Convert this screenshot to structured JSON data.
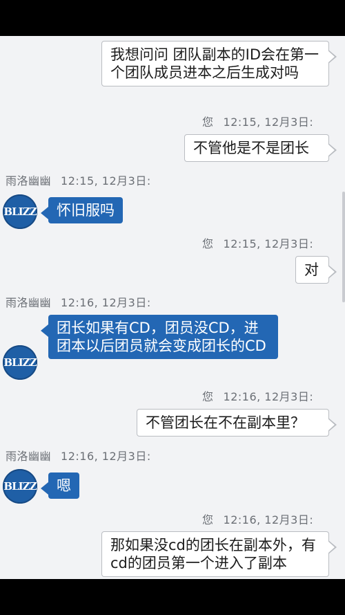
{
  "conversation": {
    "messages": [
      {
        "side": "out",
        "text": "我想问问 团队副本的ID会在第一个团队成员进本之后生成对吗"
      },
      {
        "side": "out",
        "meta_who": "您",
        "meta_time": "12:15, 12月3日:",
        "text": "不管他是不是团长"
      },
      {
        "side": "in",
        "meta_who": "雨洛幽幽",
        "meta_time": "12:15, 12月3日:",
        "avatar": "BLIZZ",
        "text": "怀旧服吗"
      },
      {
        "side": "out",
        "meta_who": "您",
        "meta_time": "12:15, 12月3日:",
        "text": "对"
      },
      {
        "side": "in",
        "meta_who": "雨洛幽幽",
        "meta_time": "12:16, 12月3日:",
        "avatar": "BLIZZ",
        "text": "团长如果有CD，团员没CD，进团本以后团员就会变成团长的CD"
      },
      {
        "side": "out",
        "meta_who": "您",
        "meta_time": "12:16, 12月3日:",
        "text": "不管团长在不在副本里？"
      },
      {
        "side": "in",
        "meta_who": "雨洛幽幽",
        "meta_time": "12:16, 12月3日:",
        "avatar": "BLIZZ",
        "text": "嗯"
      },
      {
        "side": "out",
        "meta_who": "您",
        "meta_time": "12:16, 12月3日:",
        "text": "那如果没cd的团长在副本外，有cd的团员第一个进入了副本"
      }
    ]
  },
  "colors": {
    "agent_bubble": "#2367b4",
    "user_bubble": "#ffffff",
    "background": "#f2f3f5"
  },
  "icons": {
    "avatar": "blizzard-logo-icon",
    "scrollbar": "scrollbar-thumb"
  }
}
